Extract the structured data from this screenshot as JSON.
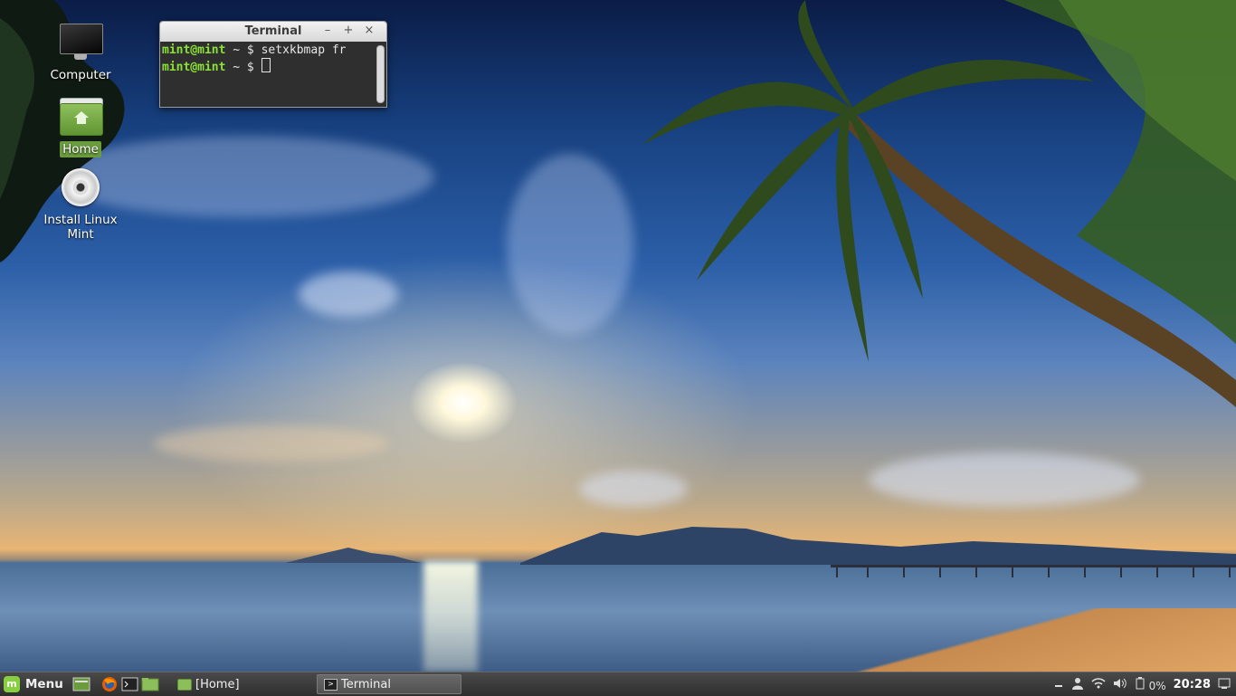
{
  "desktop": {
    "icons": [
      {
        "label": "Computer"
      },
      {
        "label": "Home"
      },
      {
        "label": "Install Linux Mint"
      }
    ]
  },
  "terminal": {
    "title": "Terminal",
    "minimize": "–",
    "maximize": "+",
    "close": "×",
    "lines": [
      {
        "user": "mint@mint",
        "path": " ~ $ ",
        "command": "setxkbmap fr"
      },
      {
        "user": "mint@mint",
        "path": " ~ $ ",
        "command": ""
      }
    ]
  },
  "taskbar": {
    "menu_label": "Menu",
    "windows": [
      {
        "label": "[Home]"
      },
      {
        "label": "Terminal"
      }
    ],
    "tray": {
      "battery_text": "0%",
      "clock": "20:28"
    }
  },
  "colors": {
    "prompt_user": "#8ae234",
    "mint_green": "#87cf3e",
    "selection": "#6a9c3e"
  }
}
